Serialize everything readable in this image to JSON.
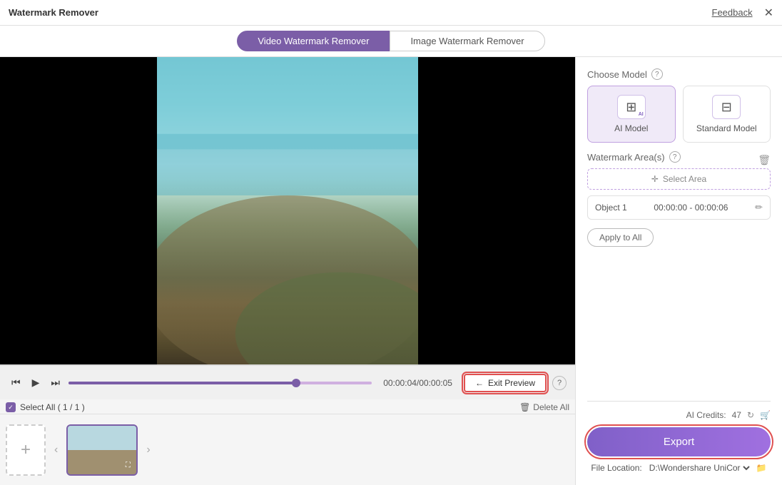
{
  "app": {
    "title": "Watermark Remover",
    "feedback_label": "Feedback",
    "close_label": "✕"
  },
  "tabs": {
    "video_tab": "Video Watermark Remover",
    "image_tab": "Image Watermark Remover"
  },
  "controls": {
    "prev_label": "⏮",
    "play_label": "▶",
    "next_label": "⏭",
    "time": "00:00:04/00:00:05",
    "exit_preview": "Exit Preview",
    "help": "?"
  },
  "file_strip": {
    "select_all": "Select All ( 1 / 1 )",
    "delete_all": "Delete All",
    "add_icon": "+"
  },
  "right_panel": {
    "choose_model_label": "Choose Model",
    "ai_model_label": "AI Model",
    "standard_model_label": "Standard Model",
    "watermark_areas_label": "Watermark Area(s)",
    "select_area_label": "Select Area",
    "object1_label": "Object 1",
    "object1_time": "00:00:00 - 00:00:06",
    "apply_all_label": "Apply to All",
    "ai_credits_label": "AI Credits:",
    "ai_credits_value": "47",
    "export_label": "Export",
    "file_location_label": "File Location:",
    "file_location_path": "D:\\Wondershare UniCor"
  }
}
